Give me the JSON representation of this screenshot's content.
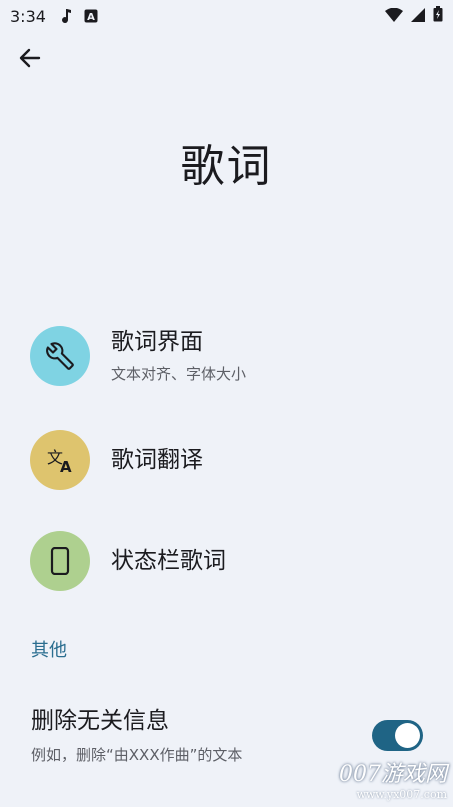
{
  "status_bar": {
    "time": "3:34"
  },
  "header": {
    "back_icon": "arrow-left-icon",
    "title": "歌词"
  },
  "menu": [
    {
      "title": "歌词界面",
      "subtitle": "文本对齐、字体大小",
      "icon": "wrench-icon",
      "color": "#7fd3e3"
    },
    {
      "title": "歌词翻译",
      "subtitle": "",
      "icon": "translate-icon",
      "color": "#dec46e"
    },
    {
      "title": "状态栏歌词",
      "subtitle": "",
      "icon": "phone-icon",
      "color": "#aed08f"
    }
  ],
  "other_section": {
    "header": "其他",
    "toggle": {
      "title": "删除无关信息",
      "subtitle": "例如，删除“由XXX作曲”的文本",
      "enabled": true
    }
  },
  "watermark": {
    "main": "007游戏网",
    "url": "www.yx007.com"
  },
  "colors": {
    "background": "#eff2f8",
    "accent": "#1f6485",
    "section_header": "#2a6d8f"
  }
}
